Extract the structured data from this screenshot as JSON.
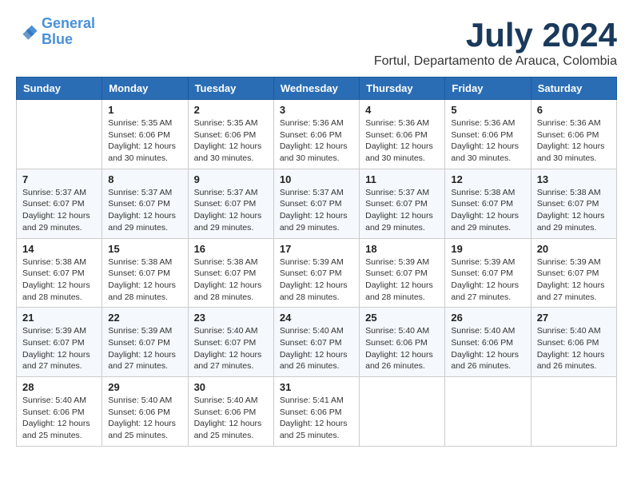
{
  "logo": {
    "line1": "General",
    "line2": "Blue"
  },
  "title": "July 2024",
  "subtitle": "Fortul, Departamento de Arauca, Colombia",
  "headers": [
    "Sunday",
    "Monday",
    "Tuesday",
    "Wednesday",
    "Thursday",
    "Friday",
    "Saturday"
  ],
  "weeks": [
    [
      {
        "day": "",
        "info": ""
      },
      {
        "day": "1",
        "info": "Sunrise: 5:35 AM\nSunset: 6:06 PM\nDaylight: 12 hours\nand 30 minutes."
      },
      {
        "day": "2",
        "info": "Sunrise: 5:35 AM\nSunset: 6:06 PM\nDaylight: 12 hours\nand 30 minutes."
      },
      {
        "day": "3",
        "info": "Sunrise: 5:36 AM\nSunset: 6:06 PM\nDaylight: 12 hours\nand 30 minutes."
      },
      {
        "day": "4",
        "info": "Sunrise: 5:36 AM\nSunset: 6:06 PM\nDaylight: 12 hours\nand 30 minutes."
      },
      {
        "day": "5",
        "info": "Sunrise: 5:36 AM\nSunset: 6:06 PM\nDaylight: 12 hours\nand 30 minutes."
      },
      {
        "day": "6",
        "info": "Sunrise: 5:36 AM\nSunset: 6:06 PM\nDaylight: 12 hours\nand 30 minutes."
      }
    ],
    [
      {
        "day": "7",
        "info": "Sunrise: 5:37 AM\nSunset: 6:07 PM\nDaylight: 12 hours\nand 29 minutes."
      },
      {
        "day": "8",
        "info": "Sunrise: 5:37 AM\nSunset: 6:07 PM\nDaylight: 12 hours\nand 29 minutes."
      },
      {
        "day": "9",
        "info": "Sunrise: 5:37 AM\nSunset: 6:07 PM\nDaylight: 12 hours\nand 29 minutes."
      },
      {
        "day": "10",
        "info": "Sunrise: 5:37 AM\nSunset: 6:07 PM\nDaylight: 12 hours\nand 29 minutes."
      },
      {
        "day": "11",
        "info": "Sunrise: 5:37 AM\nSunset: 6:07 PM\nDaylight: 12 hours\nand 29 minutes."
      },
      {
        "day": "12",
        "info": "Sunrise: 5:38 AM\nSunset: 6:07 PM\nDaylight: 12 hours\nand 29 minutes."
      },
      {
        "day": "13",
        "info": "Sunrise: 5:38 AM\nSunset: 6:07 PM\nDaylight: 12 hours\nand 29 minutes."
      }
    ],
    [
      {
        "day": "14",
        "info": "Sunrise: 5:38 AM\nSunset: 6:07 PM\nDaylight: 12 hours\nand 28 minutes."
      },
      {
        "day": "15",
        "info": "Sunrise: 5:38 AM\nSunset: 6:07 PM\nDaylight: 12 hours\nand 28 minutes."
      },
      {
        "day": "16",
        "info": "Sunrise: 5:38 AM\nSunset: 6:07 PM\nDaylight: 12 hours\nand 28 minutes."
      },
      {
        "day": "17",
        "info": "Sunrise: 5:39 AM\nSunset: 6:07 PM\nDaylight: 12 hours\nand 28 minutes."
      },
      {
        "day": "18",
        "info": "Sunrise: 5:39 AM\nSunset: 6:07 PM\nDaylight: 12 hours\nand 28 minutes."
      },
      {
        "day": "19",
        "info": "Sunrise: 5:39 AM\nSunset: 6:07 PM\nDaylight: 12 hours\nand 27 minutes."
      },
      {
        "day": "20",
        "info": "Sunrise: 5:39 AM\nSunset: 6:07 PM\nDaylight: 12 hours\nand 27 minutes."
      }
    ],
    [
      {
        "day": "21",
        "info": "Sunrise: 5:39 AM\nSunset: 6:07 PM\nDaylight: 12 hours\nand 27 minutes."
      },
      {
        "day": "22",
        "info": "Sunrise: 5:39 AM\nSunset: 6:07 PM\nDaylight: 12 hours\nand 27 minutes."
      },
      {
        "day": "23",
        "info": "Sunrise: 5:40 AM\nSunset: 6:07 PM\nDaylight: 12 hours\nand 27 minutes."
      },
      {
        "day": "24",
        "info": "Sunrise: 5:40 AM\nSunset: 6:07 PM\nDaylight: 12 hours\nand 26 minutes."
      },
      {
        "day": "25",
        "info": "Sunrise: 5:40 AM\nSunset: 6:06 PM\nDaylight: 12 hours\nand 26 minutes."
      },
      {
        "day": "26",
        "info": "Sunrise: 5:40 AM\nSunset: 6:06 PM\nDaylight: 12 hours\nand 26 minutes."
      },
      {
        "day": "27",
        "info": "Sunrise: 5:40 AM\nSunset: 6:06 PM\nDaylight: 12 hours\nand 26 minutes."
      }
    ],
    [
      {
        "day": "28",
        "info": "Sunrise: 5:40 AM\nSunset: 6:06 PM\nDaylight: 12 hours\nand 25 minutes."
      },
      {
        "day": "29",
        "info": "Sunrise: 5:40 AM\nSunset: 6:06 PM\nDaylight: 12 hours\nand 25 minutes."
      },
      {
        "day": "30",
        "info": "Sunrise: 5:40 AM\nSunset: 6:06 PM\nDaylight: 12 hours\nand 25 minutes."
      },
      {
        "day": "31",
        "info": "Sunrise: 5:41 AM\nSunset: 6:06 PM\nDaylight: 12 hours\nand 25 minutes."
      },
      {
        "day": "",
        "info": ""
      },
      {
        "day": "",
        "info": ""
      },
      {
        "day": "",
        "info": ""
      }
    ]
  ]
}
